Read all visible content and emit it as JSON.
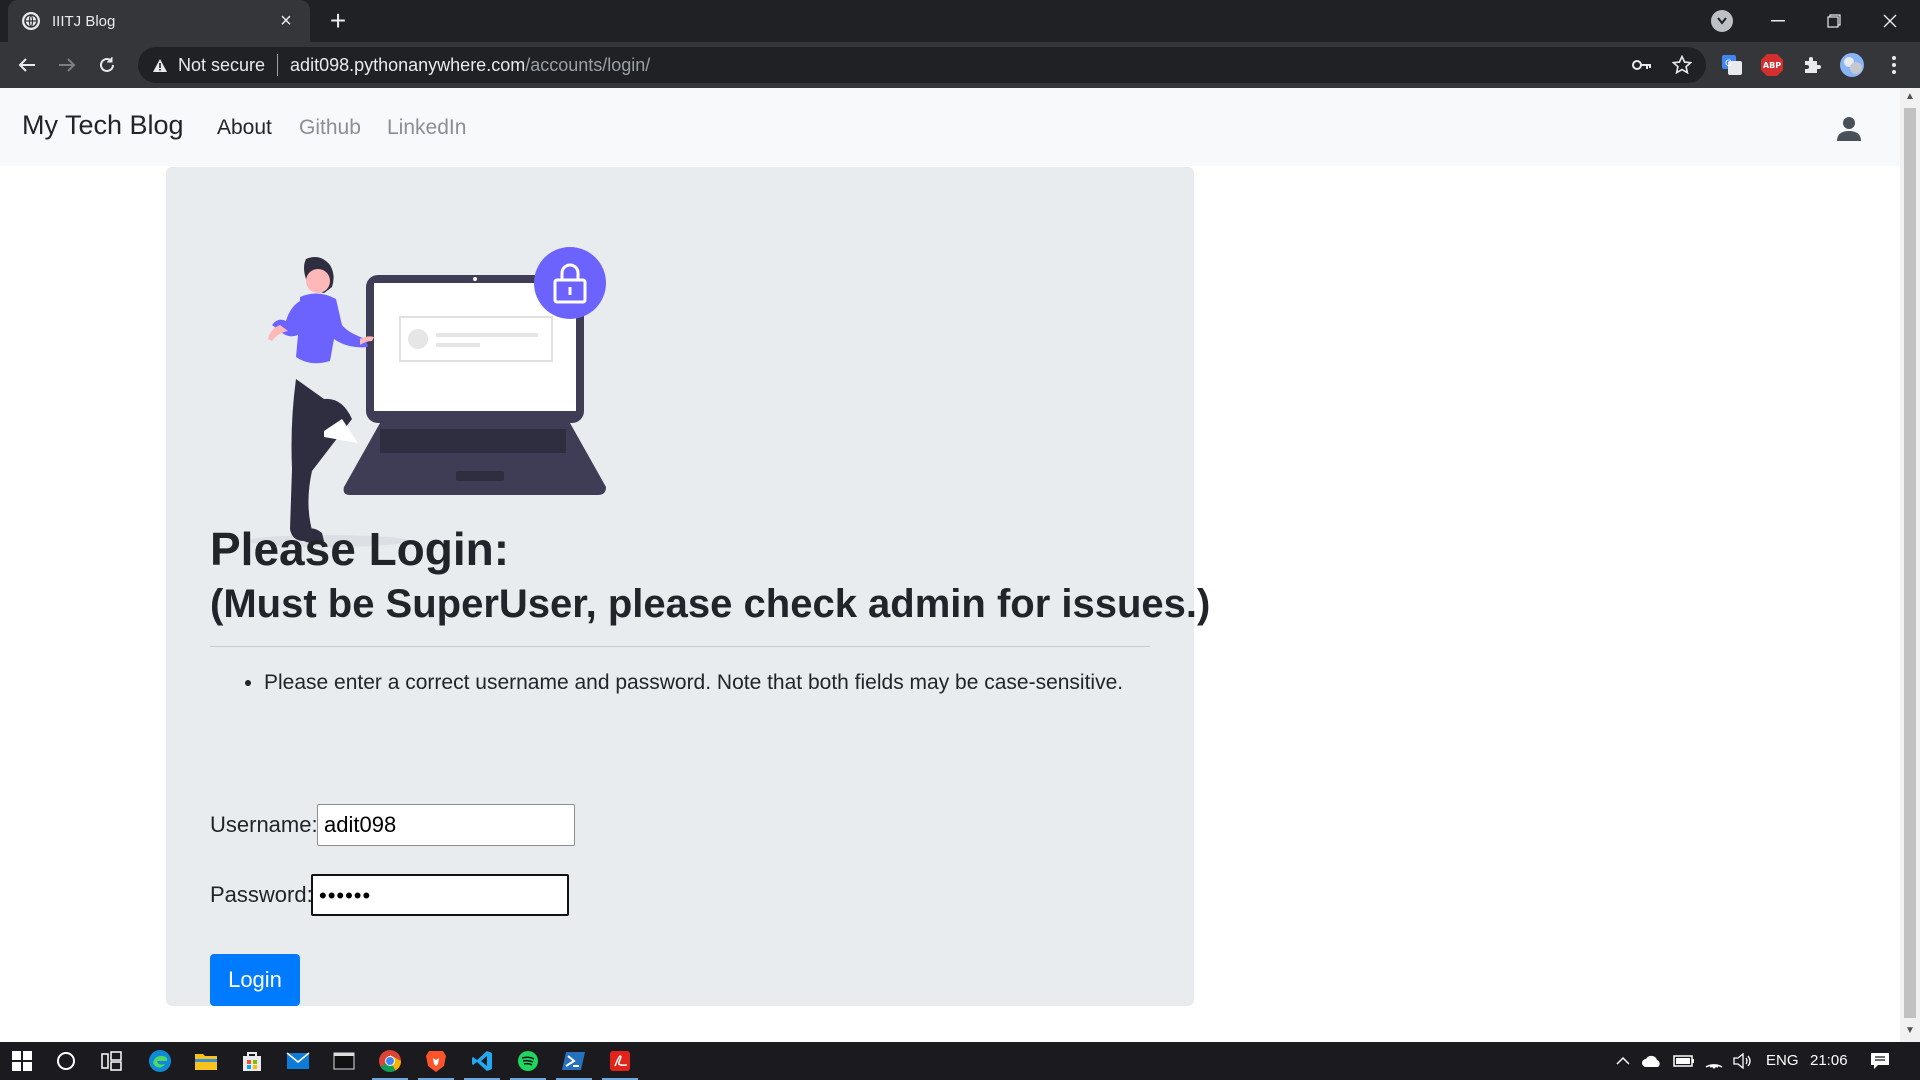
{
  "browser": {
    "tab_title": "IIITJ Blog",
    "security_label": "Not secure",
    "url_host": "adit098.pythonanywhere.com",
    "url_path": "/accounts/login/",
    "ext_abp": "ABP"
  },
  "navbar": {
    "brand": "My Tech Blog",
    "links": [
      "About",
      "Github",
      "LinkedIn"
    ]
  },
  "login": {
    "heading": "Please Login:",
    "subheading": "(Must be SuperUser, please check admin for issues.)",
    "errors": [
      "Please enter a correct username and password. Note that both fields may be case-sensitive."
    ],
    "username_label": "Username:",
    "username_value": "adit098",
    "password_label": "Password:",
    "password_value": "••••••",
    "submit_label": "Login"
  },
  "taskbar": {
    "language": "ENG",
    "time": "21:06"
  },
  "colors": {
    "primary_button": "#007bff",
    "card_background": "#e9ecef",
    "illustration_accent": "#6c63ff"
  }
}
